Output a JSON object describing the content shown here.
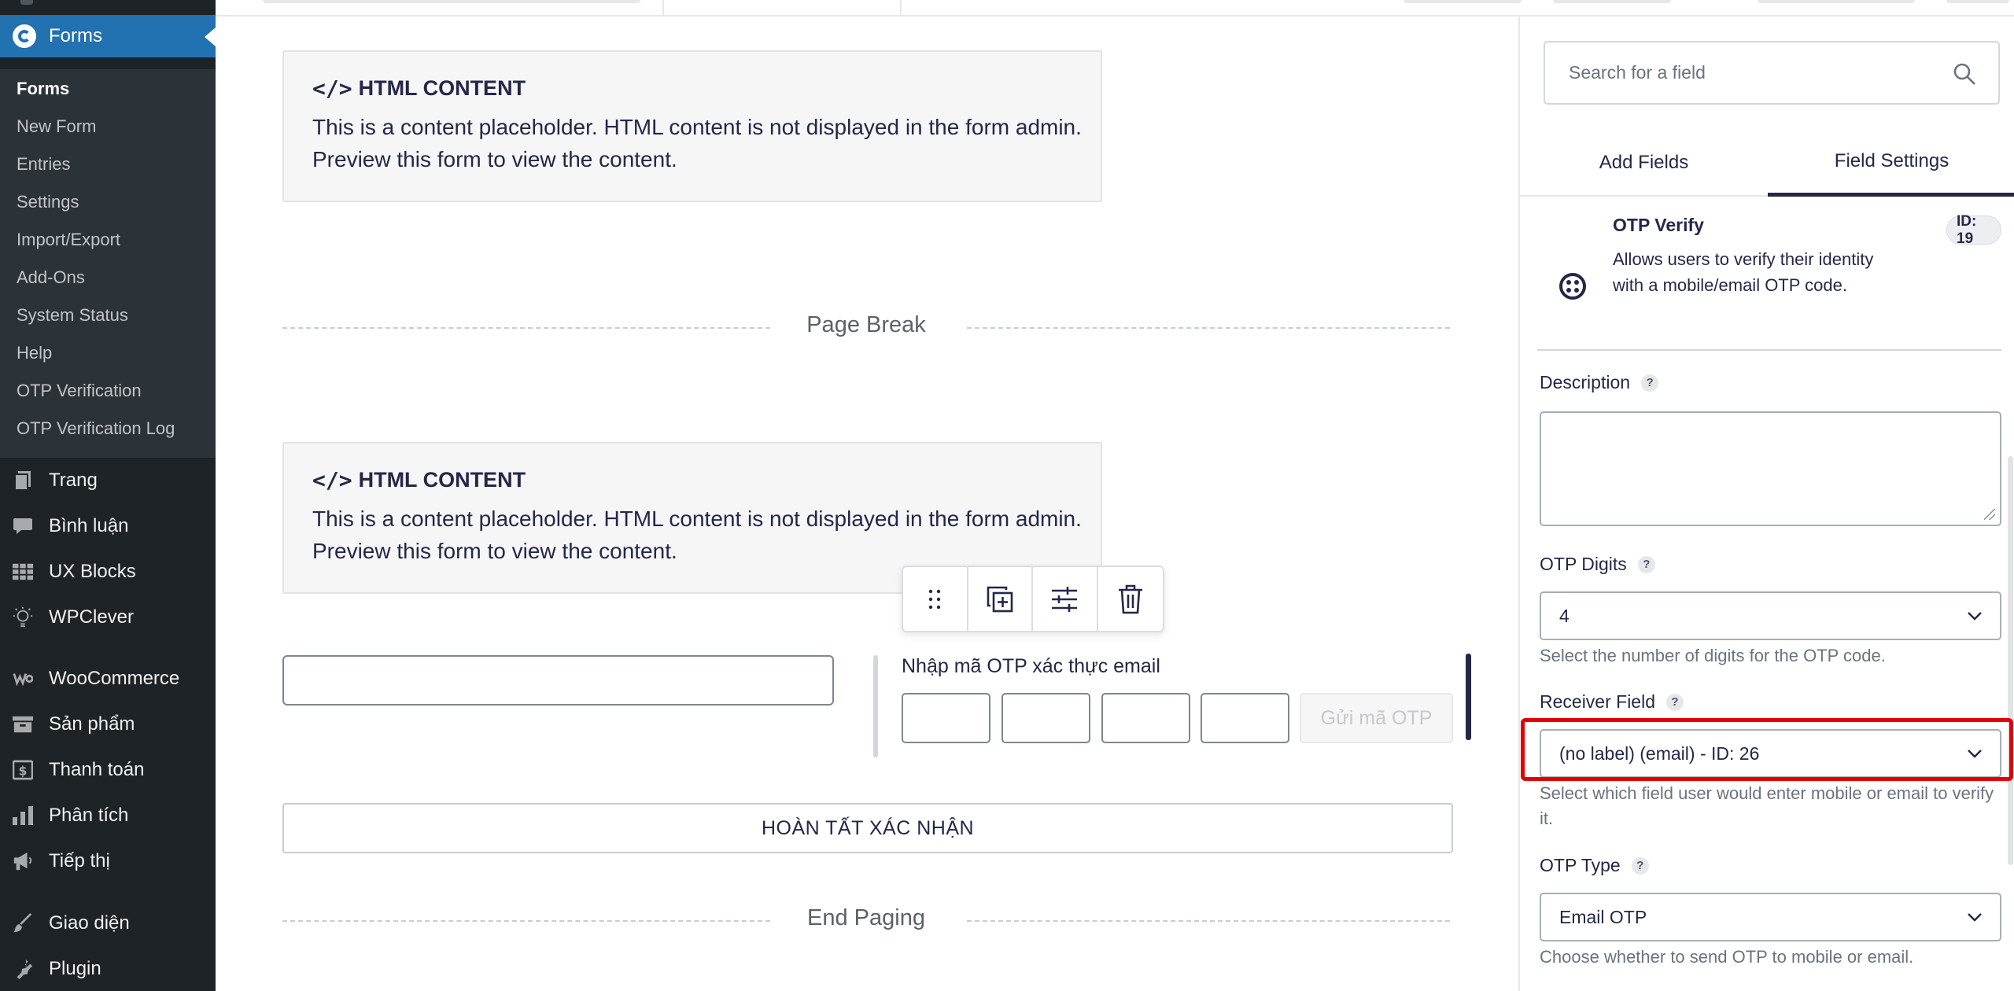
{
  "sidebar": {
    "forms_label": "Forms",
    "sub_items": [
      {
        "label": "Forms",
        "active": true
      },
      {
        "label": "New Form"
      },
      {
        "label": "Entries"
      },
      {
        "label": "Settings"
      },
      {
        "label": "Import/Export"
      },
      {
        "label": "Add-Ons"
      },
      {
        "label": "System Status"
      },
      {
        "label": "Help"
      },
      {
        "label": "OTP Verification"
      },
      {
        "label": "OTP Verification Log"
      }
    ],
    "menu_items": [
      {
        "label": "Trang",
        "icon": "pages-icon"
      },
      {
        "label": "Bình luận",
        "icon": "comments-icon"
      },
      {
        "label": "UX Blocks",
        "icon": "grid-icon"
      },
      {
        "label": "WPClever",
        "icon": "lightbulb-icon"
      },
      {
        "label": "WooCommerce",
        "icon": "woocommerce-icon"
      },
      {
        "label": "Sản phẩm",
        "icon": "archive-icon"
      },
      {
        "label": "Thanh toán",
        "icon": "dollar-icon"
      },
      {
        "label": "Phân tích",
        "icon": "bar-chart-icon"
      },
      {
        "label": "Tiếp thị",
        "icon": "megaphone-icon"
      },
      {
        "label": "Giao diện",
        "icon": "paintbrush-icon"
      },
      {
        "label": "Plugin",
        "icon": "plugin-icon"
      }
    ]
  },
  "canvas": {
    "html_block_1": {
      "title": "HTML CONTENT",
      "text": "This is a content placeholder. HTML content is not displayed in the form admin. Preview this form to view the content."
    },
    "page_break_label": "Page Break",
    "html_block_2": {
      "title": "HTML CONTENT",
      "text": "This is a content placeholder. HTML content is not displayed in the form admin. Preview this form to view the content."
    },
    "otp_field": {
      "label": "Nhập mã OTP xác thực email",
      "send_button": "Gửi mã OTP"
    },
    "finish_button": "HOÀN TẤT XÁC NHẬN",
    "end_paging_label": "End Paging"
  },
  "panel": {
    "search_placeholder": "Search for a field",
    "tabs": {
      "add_fields": "Add Fields",
      "field_settings": "Field Settings"
    },
    "field_info": {
      "title": "OTP Verify",
      "description": "Allows users to verify their identity with a mobile/email OTP code.",
      "id_badge": "ID: 19"
    },
    "description_label": "Description",
    "otp_digits": {
      "label": "OTP Digits",
      "value": "4",
      "hint": "Select the number of digits for the OTP code."
    },
    "receiver_field": {
      "label": "Receiver Field",
      "value": "(no label) (email) - ID: 26",
      "hint": "Select which field user would enter mobile or email to verify it."
    },
    "otp_type": {
      "label": "OTP Type",
      "value": "Email OTP",
      "hint": "Choose whether to send OTP to mobile or email."
    },
    "help_mark": "?"
  },
  "colors": {
    "sidebar_bg": "#1d2327",
    "submenu_bg": "#2c3338",
    "accent_blue": "#2271b1",
    "dark_text": "#242748",
    "highlight_red": "#e50000"
  }
}
